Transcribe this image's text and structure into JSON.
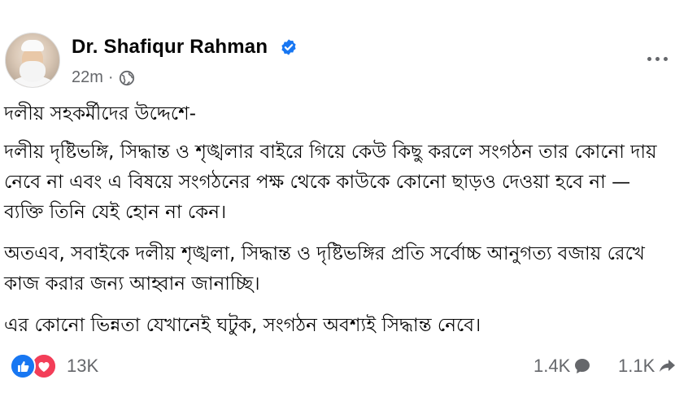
{
  "post": {
    "author": "Dr. Shafiqur Rahman",
    "time": "22m",
    "separator": "·",
    "paragraphs": [
      "দলীয় সহকর্মীদের উদ্দেশে-",
      "দলীয় দৃষ্টিভঙ্গি, সিদ্ধান্ত ও শৃঙ্খলার বাইরে গিয়ে কেউ কিছু করলে সংগঠন তার কোনো দায় নেবে না এবং এ বিষয়ে সংগঠনের পক্ষ থেকে কাউকে কোনো ছাড়ও দেওয়া হবে না — ব্যক্তি তিনি যেই হোন না কেন।",
      "অতএব, সবাইকে দলীয় শৃঙ্খলা, সিদ্ধান্ত ও দৃষ্টিভঙ্গির প্রতি সর্বোচ্চ আনুগত্য বজায় রেখে কাজ করার জন্য আহ্বান জানাচ্ছি।",
      "এর কোনো ভিন্নতা যেখানেই ঘটুক, সংগঠন অবশ্যই সিদ্ধান্ত নেবে।"
    ]
  },
  "stats": {
    "reactions": "13K",
    "comments": "1.4K",
    "shares": "1.1K"
  },
  "icons": {
    "verified": "verified-badge-icon",
    "audience": "globe-icon",
    "more": "more-options-icon",
    "like": "like-reaction-icon",
    "love": "love-reaction-icon",
    "comment": "comment-icon",
    "share": "share-icon"
  },
  "colors": {
    "accent": "#1877f2",
    "love": "#f33e58",
    "secondary_text": "#65676b"
  }
}
